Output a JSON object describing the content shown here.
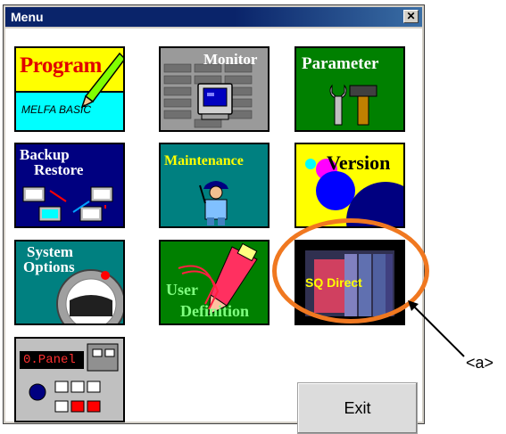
{
  "window": {
    "title": "Menu",
    "close_glyph": "✕"
  },
  "tiles": {
    "program": {
      "title": "Program",
      "subtitle": "MELFA BASIC"
    },
    "monitor": {
      "title": "Monitor"
    },
    "parameter": {
      "title": "Parameter"
    },
    "backup": {
      "line1": "Backup",
      "line2": "Restore"
    },
    "maintenance": {
      "title": "Maintenance"
    },
    "version": {
      "title": "Version"
    },
    "system": {
      "line1": "System",
      "line2": "Options"
    },
    "user": {
      "line1": "User",
      "line2": "Definition"
    },
    "sqdirect": {
      "title": "SQ Direct"
    },
    "opanel": {
      "title": "0.Panel"
    }
  },
  "exit_label": "Exit",
  "annotation": {
    "label": "<a>"
  },
  "colors": {
    "title_bar": "#0a246a",
    "callout": "#f07820",
    "program_top": "#ffff00",
    "program_bottom": "#00ffff",
    "teal": "#008080",
    "navy": "#000080",
    "green": "#008000"
  },
  "icons": [
    "pencil-icon",
    "monitor-icon",
    "wrench-hammer-icon",
    "computer-transfer-icon",
    "worker-icon",
    "circles-icon",
    "system-dial-icon",
    "pen-icon",
    "sq-panel-icon",
    "operation-panel-icon",
    "close-icon"
  ]
}
